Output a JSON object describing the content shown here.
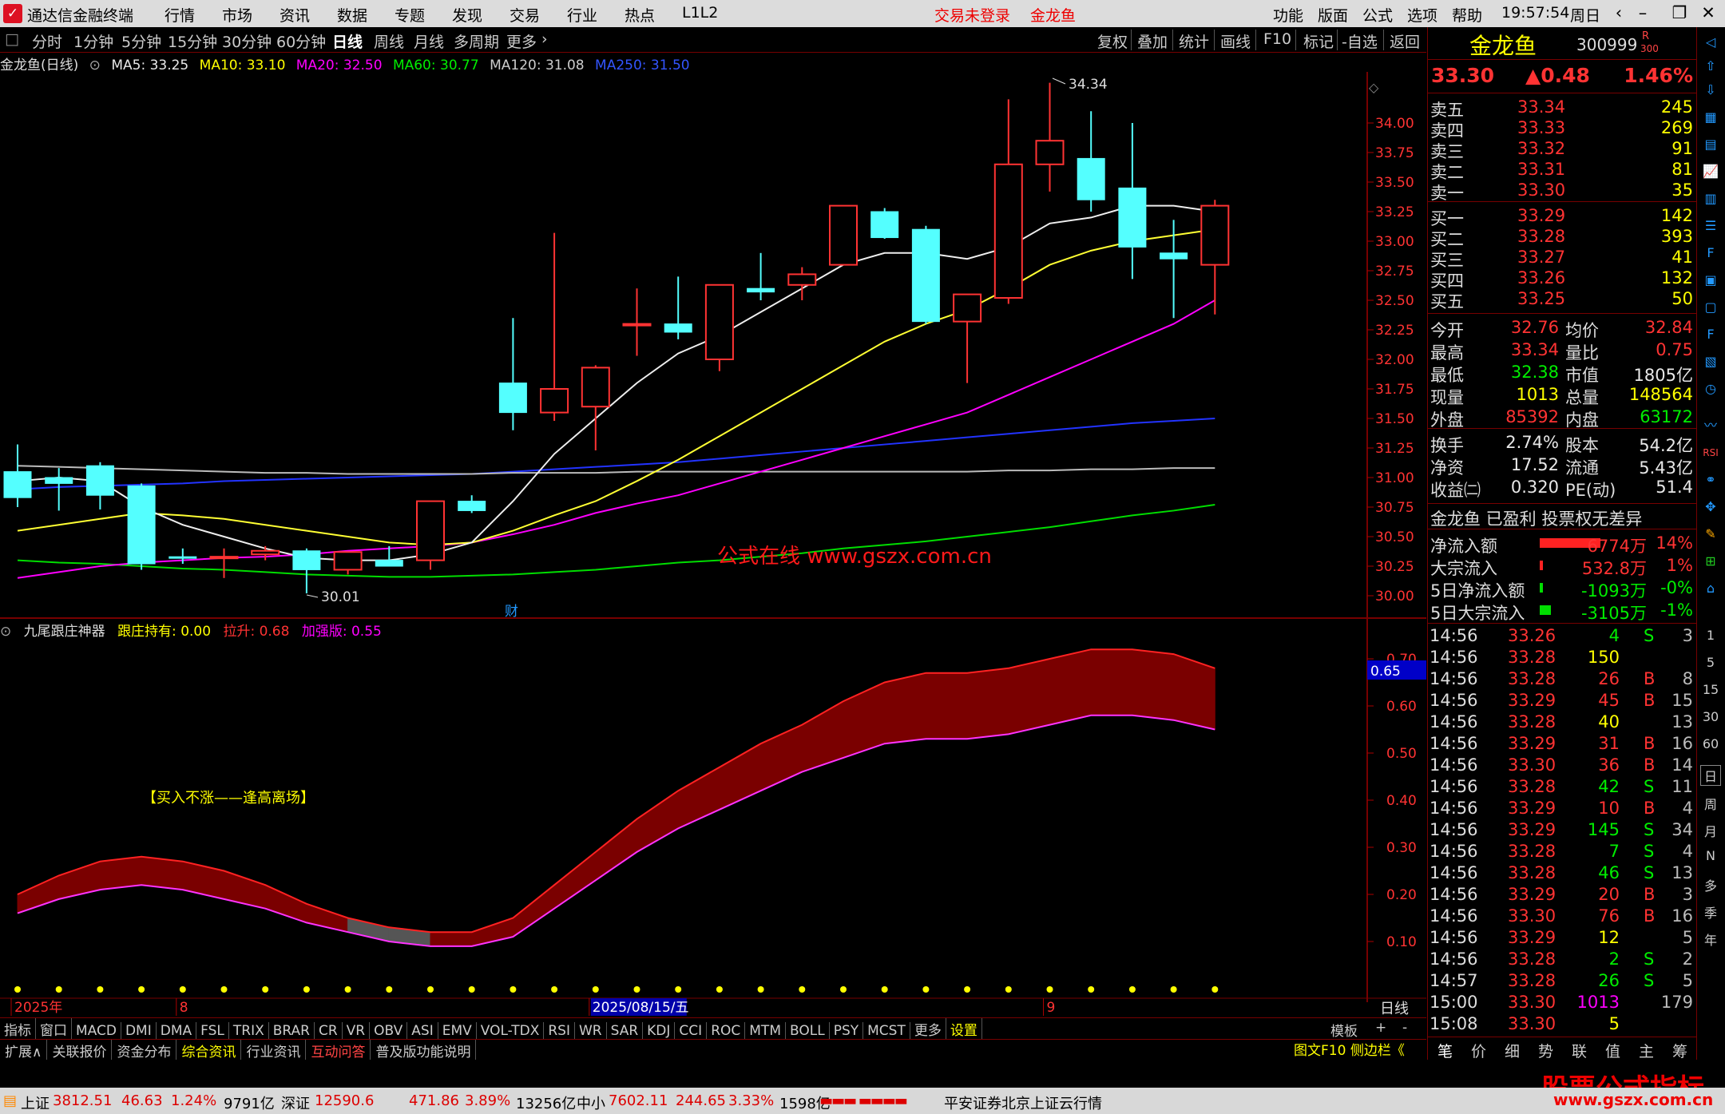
{
  "titlebar": {
    "app_title": "通达信金融终端",
    "menu": [
      "行情",
      "市场",
      "资讯",
      "数据",
      "专题",
      "发现",
      "交易",
      "行业",
      "热点",
      "L1L2"
    ],
    "login_status": "交易未登录",
    "stock_name": "金龙鱼",
    "right_menu": [
      "功能",
      "版面",
      "公式",
      "选项",
      "帮助"
    ],
    "time": "19:57:54",
    "weekday": "周日"
  },
  "toolbar": {
    "periods": [
      "分时",
      "1分钟",
      "5分钟",
      "15分钟",
      "30分钟",
      "60分钟",
      "日线",
      "周线",
      "月线",
      "多周期",
      "更多"
    ],
    "active": "日线",
    "right": [
      "复权",
      "叠加",
      "统计",
      "画线",
      "F10",
      "标记",
      "-自选",
      "返回"
    ]
  },
  "main": {
    "title": "金龙鱼(日线)",
    "ma5": "MA5: 33.25",
    "ma10": "MA10: 33.10",
    "ma20": "MA20: 32.50",
    "ma60": "MA60: 30.77",
    "ma120": "MA120: 31.08",
    "ma250": "MA250: 31.50"
  },
  "indicator": {
    "name": "九尾跟庄神器",
    "gz": "跟庄持有: 0.00",
    "ls": "拉升: 0.68",
    "jq": "加强版: 0.55",
    "cursor_value": "0.65",
    "note": "【买入不涨——逢高离场】"
  },
  "chart_data": {
    "type": "candlestick",
    "high_label": "34.34",
    "low_label": "30.01",
    "fin_marker": "财",
    "candles": [
      {
        "o": 31.05,
        "h": 31.28,
        "c": 30.83,
        "l": 30.75
      },
      {
        "o": 31.0,
        "h": 31.08,
        "c": 30.95,
        "l": 30.72
      },
      {
        "o": 31.1,
        "h": 31.13,
        "c": 30.85,
        "l": 30.73
      },
      {
        "o": 30.93,
        "h": 30.95,
        "c": 30.27,
        "l": 30.22
      },
      {
        "o": 30.33,
        "h": 30.4,
        "c": 30.32,
        "l": 30.27
      },
      {
        "o": 30.32,
        "h": 30.4,
        "c": 30.33,
        "l": 30.15
      },
      {
        "o": 30.35,
        "h": 30.42,
        "c": 30.38,
        "l": 30.3
      },
      {
        "o": 30.38,
        "h": 30.4,
        "c": 30.22,
        "l": 30.02
      },
      {
        "o": 30.22,
        "h": 30.35,
        "c": 30.37,
        "l": 30.18
      },
      {
        "o": 30.3,
        "h": 30.42,
        "c": 30.25,
        "l": 30.25
      },
      {
        "o": 30.3,
        "h": 30.8,
        "c": 30.8,
        "l": 30.22
      },
      {
        "o": 30.8,
        "h": 30.85,
        "c": 30.72,
        "l": 30.7
      },
      {
        "o": 31.8,
        "h": 32.35,
        "c": 31.55,
        "l": 31.4
      },
      {
        "o": 31.55,
        "h": 33.07,
        "c": 31.75,
        "l": 31.48
      },
      {
        "o": 31.6,
        "h": 31.95,
        "c": 31.93,
        "l": 31.23
      },
      {
        "o": 32.3,
        "h": 32.6,
        "c": 32.3,
        "l": 32.03
      },
      {
        "o": 32.3,
        "h": 32.7,
        "c": 32.23,
        "l": 32.17
      },
      {
        "o": 32.0,
        "h": 32.63,
        "c": 32.63,
        "l": 31.9
      },
      {
        "o": 32.6,
        "h": 32.9,
        "c": 32.57,
        "l": 32.5
      },
      {
        "o": 32.63,
        "h": 32.78,
        "c": 32.72,
        "l": 32.5
      },
      {
        "o": 32.8,
        "h": 33.3,
        "c": 33.3,
        "l": 32.8
      },
      {
        "o": 33.25,
        "h": 33.28,
        "c": 33.03,
        "l": 33.02
      },
      {
        "o": 33.1,
        "h": 33.13,
        "c": 32.32,
        "l": 32.3
      },
      {
        "o": 32.32,
        "h": 32.55,
        "c": 32.55,
        "l": 31.8
      },
      {
        "o": 32.52,
        "h": 34.2,
        "c": 33.65,
        "l": 32.47
      },
      {
        "o": 33.65,
        "h": 34.34,
        "c": 33.85,
        "l": 33.42
      },
      {
        "o": 33.7,
        "h": 34.1,
        "c": 33.35,
        "l": 33.25
      },
      {
        "o": 33.45,
        "h": 34.0,
        "c": 32.95,
        "l": 32.68
      },
      {
        "o": 32.9,
        "h": 33.18,
        "c": 32.85,
        "l": 32.35
      },
      {
        "o": 32.8,
        "h": 33.35,
        "c": 33.3,
        "l": 32.38
      }
    ],
    "y_ticks": [
      "34.00",
      "33.75",
      "33.50",
      "33.25",
      "33.00",
      "32.75",
      "32.50",
      "32.25",
      "32.00",
      "31.75",
      "31.50",
      "31.25",
      "31.00",
      "30.75",
      "30.50",
      "30.25",
      "30.00"
    ],
    "ind_ticks": [
      "0.70",
      "0.60",
      "0.50",
      "0.40",
      "0.30",
      "0.20",
      "0.10"
    ],
    "ma5": [
      30.97,
      31.0,
      30.97,
      30.75,
      30.6,
      30.5,
      30.4,
      30.32,
      30.3,
      30.3,
      30.35,
      30.45,
      30.8,
      31.2,
      31.5,
      31.8,
      32.05,
      32.2,
      32.4,
      32.6,
      32.8,
      32.9,
      32.9,
      32.85,
      32.95,
      33.15,
      33.2,
      33.3,
      33.3,
      33.25
    ],
    "ma10": [
      30.55,
      30.6,
      30.65,
      30.7,
      30.68,
      30.65,
      30.6,
      30.55,
      30.5,
      30.45,
      30.43,
      30.45,
      30.55,
      30.68,
      30.8,
      30.97,
      31.15,
      31.35,
      31.55,
      31.75,
      31.95,
      32.15,
      32.3,
      32.42,
      32.6,
      32.8,
      32.92,
      33.0,
      33.05,
      33.1
    ],
    "ma20": [
      30.15,
      30.2,
      30.25,
      30.28,
      30.3,
      30.32,
      30.33,
      30.35,
      30.38,
      30.4,
      30.42,
      30.45,
      30.52,
      30.6,
      30.7,
      30.78,
      30.85,
      30.95,
      31.05,
      31.15,
      31.25,
      31.35,
      31.45,
      31.55,
      31.7,
      31.85,
      32.0,
      32.15,
      32.3,
      32.5
    ],
    "ma60": [
      30.3,
      30.28,
      30.27,
      30.25,
      30.23,
      30.22,
      30.2,
      30.18,
      30.17,
      30.16,
      30.16,
      30.17,
      30.18,
      30.2,
      30.22,
      30.25,
      30.28,
      30.3,
      30.33,
      30.36,
      30.4,
      30.43,
      30.46,
      30.5,
      30.54,
      30.58,
      30.63,
      30.68,
      30.72,
      30.77
    ],
    "ma120": [
      31.1,
      31.09,
      31.08,
      31.07,
      31.06,
      31.05,
      31.04,
      31.04,
      31.03,
      31.03,
      31.03,
      31.03,
      31.04,
      31.04,
      31.04,
      31.05,
      31.05,
      31.05,
      31.05,
      31.05,
      31.05,
      31.05,
      31.05,
      31.05,
      31.06,
      31.06,
      31.07,
      31.07,
      31.08,
      31.08
    ],
    "ma250": [
      30.9,
      30.92,
      30.93,
      30.94,
      30.95,
      30.97,
      30.98,
      30.99,
      31.0,
      31.01,
      31.02,
      31.03,
      31.05,
      31.07,
      31.09,
      31.11,
      31.13,
      31.16,
      31.19,
      31.22,
      31.25,
      31.28,
      31.31,
      31.34,
      31.37,
      31.4,
      31.43,
      31.46,
      31.48,
      31.5
    ],
    "ind_upper": [
      0.2,
      0.24,
      0.27,
      0.28,
      0.27,
      0.25,
      0.22,
      0.18,
      0.15,
      0.13,
      0.12,
      0.12,
      0.15,
      0.22,
      0.29,
      0.36,
      0.42,
      0.47,
      0.52,
      0.56,
      0.61,
      0.65,
      0.67,
      0.67,
      0.68,
      0.7,
      0.72,
      0.72,
      0.71,
      0.68
    ],
    "ind_lower": [
      0.16,
      0.19,
      0.21,
      0.22,
      0.21,
      0.19,
      0.17,
      0.14,
      0.12,
      0.1,
      0.09,
      0.09,
      0.11,
      0.17,
      0.23,
      0.29,
      0.34,
      0.38,
      0.42,
      0.46,
      0.49,
      0.52,
      0.53,
      0.53,
      0.54,
      0.56,
      0.58,
      0.58,
      0.57,
      0.55
    ],
    "ind_gray_range": [
      8,
      10
    ],
    "x_labels": [
      {
        "i": 0,
        "t": "2025年"
      },
      {
        "i": 4,
        "t": "8"
      },
      {
        "i": 14,
        "t": "2025/08/15/五"
      },
      {
        "i": 25,
        "t": "9"
      }
    ],
    "watermark": "公式在线 www.gszx.com.cn"
  },
  "tabs": [
    "指标",
    "窗口",
    "MACD",
    "DMI",
    "DMA",
    "FSL",
    "TRIX",
    "BRAR",
    "CR",
    "VR",
    "OBV",
    "ASI",
    "EMV",
    "VOL-TDX",
    "RSI",
    "WR",
    "SAR",
    "KDJ",
    "CCI",
    "ROC",
    "MTM",
    "BOLL",
    "PSY",
    "MCST",
    "更多",
    "设置"
  ],
  "tabs_right": [
    "模板",
    "+",
    "-"
  ],
  "period_label": "日线",
  "bottom_tabs": [
    "扩展∧",
    "关联报价",
    "资金分布",
    "综合资讯",
    "行业资讯",
    "互动问答",
    "普及版功能说明"
  ],
  "bottom_right": "图文F10 侧边栏《",
  "panel": {
    "name": "金龙鱼",
    "code": "300999",
    "rflag": "R",
    "subflag": "300",
    "price": "33.30",
    "change": "▲0.48",
    "pct": "1.46%",
    "asks": [
      [
        "卖五",
        "33.34",
        "245"
      ],
      [
        "卖四",
        "33.33",
        "269"
      ],
      [
        "卖三",
        "33.32",
        "91"
      ],
      [
        "卖二",
        "33.31",
        "81"
      ],
      [
        "卖一",
        "33.30",
        "35"
      ]
    ],
    "bids": [
      [
        "买一",
        "33.29",
        "142"
      ],
      [
        "买二",
        "33.28",
        "393"
      ],
      [
        "买三",
        "33.27",
        "41"
      ],
      [
        "买四",
        "33.26",
        "132"
      ],
      [
        "买五",
        "33.25",
        "50"
      ]
    ],
    "stats": [
      [
        "今开",
        "32.76",
        "均价",
        "32.84"
      ],
      [
        "最高",
        "33.34",
        "量比",
        "0.75"
      ],
      [
        "最低",
        "32.38",
        "市值",
        "1805亿"
      ],
      [
        "现量",
        "1013",
        "总量",
        "148564"
      ],
      [
        "外盘",
        "85392",
        "内盘",
        "63172"
      ]
    ],
    "stats2": [
      [
        "换手",
        "2.74%",
        "股本",
        "54.2亿"
      ],
      [
        "净资",
        "17.52",
        "流通",
        "5.43亿"
      ],
      [
        "收益㈡",
        "0.320",
        "PE(动)",
        "51.4"
      ]
    ],
    "info": "金龙鱼 已盈利 投票权无差异",
    "flows": [
      [
        "净流入额",
        "6774万",
        "14%"
      ],
      [
        "大宗流入",
        "532.8万",
        "1%"
      ],
      [
        "5日净流入额",
        "-1093万",
        "-0%"
      ],
      [
        "5日大宗流入",
        "-3105万",
        "-1%"
      ]
    ],
    "ticks": [
      [
        "14:56",
        "33.26",
        "4",
        "S",
        "3"
      ],
      [
        "14:56",
        "33.28",
        "150",
        "",
        ""
      ],
      [
        "14:56",
        "33.28",
        "26",
        "B",
        "8"
      ],
      [
        "14:56",
        "33.29",
        "45",
        "B",
        "15"
      ],
      [
        "14:56",
        "33.28",
        "40",
        "",
        "13"
      ],
      [
        "14:56",
        "33.29",
        "31",
        "B",
        "16"
      ],
      [
        "14:56",
        "33.30",
        "36",
        "B",
        "14"
      ],
      [
        "14:56",
        "33.28",
        "42",
        "S",
        "11"
      ],
      [
        "14:56",
        "33.29",
        "10",
        "B",
        "4"
      ],
      [
        "14:56",
        "33.29",
        "145",
        "S",
        "34"
      ],
      [
        "14:56",
        "33.28",
        "7",
        "S",
        "4"
      ],
      [
        "14:56",
        "33.28",
        "46",
        "S",
        "13"
      ],
      [
        "14:56",
        "33.29",
        "20",
        "B",
        "3"
      ],
      [
        "14:56",
        "33.30",
        "76",
        "B",
        "16"
      ],
      [
        "14:56",
        "33.29",
        "12",
        "",
        "5"
      ],
      [
        "14:56",
        "33.28",
        "2",
        "S",
        "2"
      ],
      [
        "14:57",
        "33.28",
        "26",
        "S",
        "5"
      ],
      [
        "15:00",
        "33.30",
        "1013",
        "",
        "179"
      ],
      [
        "15:08",
        "33.30",
        "5",
        "",
        ""
      ]
    ],
    "tabs": [
      "笔",
      "价",
      "细",
      "势",
      "联",
      "值",
      "主",
      "筹"
    ]
  },
  "sidebar_labels": [
    "1",
    "5",
    "15",
    "30",
    "60",
    "日",
    "周",
    "月",
    "N",
    "多",
    "季",
    "年"
  ],
  "status": {
    "sh_name": "上证",
    "sh": "3812.51",
    "sh_chg": "46.63",
    "sh_pct": "1.24%",
    "sh_amt": "9791亿",
    "sz_name": "深证",
    "sz": "12590.6",
    "sz_chg": "471.86",
    "sz_pct": "3.89%",
    "sz_amt": "13256亿",
    "zx_name": "中小",
    "zx": "7602.11",
    "zx_chg": "244.65",
    "zx_pct": "3.33%",
    "zx_amt": "1598亿",
    "server": "平安证券北京上证云行情"
  },
  "brand": {
    "cn": "股票公式指标网",
    "url": "www.gszx.com.cn"
  }
}
